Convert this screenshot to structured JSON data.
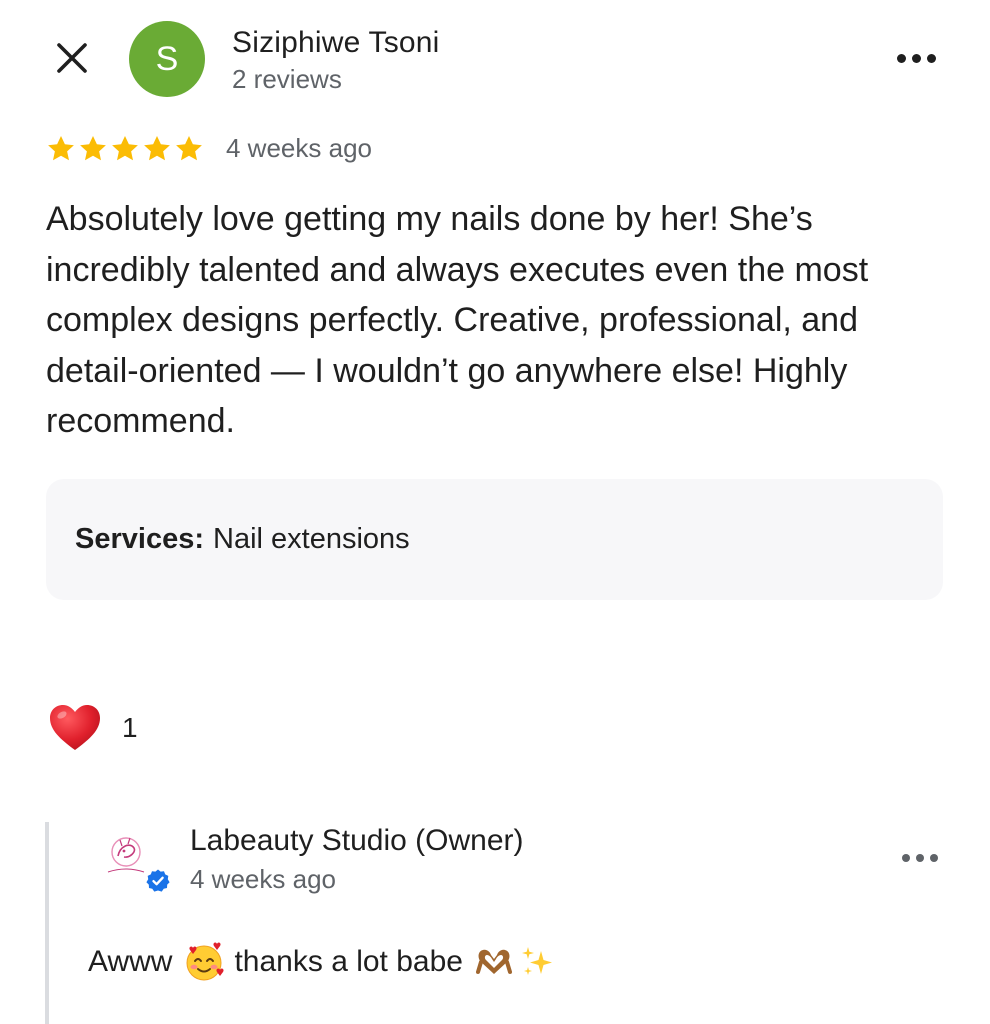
{
  "header": {
    "close_icon": "close-icon",
    "avatar_initial": "S",
    "avatar_color": "#6aab35",
    "reviewer_name": "Siziphiwe Tsoni",
    "reviewer_meta": "2 reviews",
    "more_icon": "more-horizontal-icon"
  },
  "review": {
    "rating": 5,
    "star_color": "#fbbc04",
    "date": "4 weeks ago",
    "text": "Absolutely love getting my nails done by her! She’s incredibly talented and always executes even the most complex designs perfectly. Creative, professional, and detail-oriented — I wouldn’t go anywhere else! Highly recommend.",
    "services_label": "Services:",
    "services_value": "Nail extensions"
  },
  "reactions": {
    "heart_icon": "heart-icon",
    "heart_color": "#e0202c",
    "count": "1"
  },
  "owner_reply": {
    "logo_icon": "studio-logo-icon",
    "verified_icon": "verified-badge-icon",
    "verified_color": "#1a73e8",
    "name": "Labeauty Studio (Owner)",
    "date": "4 weeks ago",
    "text_start": "Awww",
    "text_middle": "thanks a lot babe",
    "emojis": [
      "smiling-face-with-hearts-icon",
      "heart-hands-icon",
      "sparkles-icon"
    ]
  }
}
